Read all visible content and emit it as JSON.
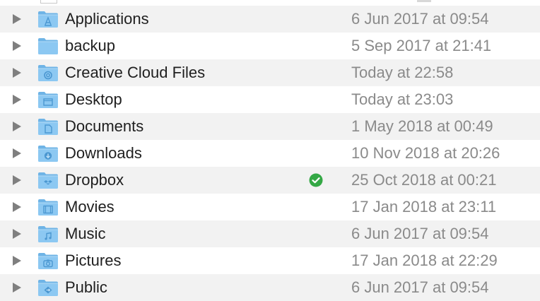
{
  "rows": [
    {
      "name": "Applications",
      "date": "6 Jun 2017 at 09:54",
      "icon": "applications-folder-icon",
      "glyph": "A"
    },
    {
      "name": "backup",
      "date": "5 Sep 2017 at 21:41",
      "icon": "folder-icon",
      "glyph": ""
    },
    {
      "name": "Creative Cloud Files",
      "date": "Today at 22:58",
      "icon": "creative-cloud-folder-icon",
      "glyph": "cc"
    },
    {
      "name": "Desktop",
      "date": "Today at 23:03",
      "icon": "desktop-folder-icon",
      "glyph": "desktop"
    },
    {
      "name": "Documents",
      "date": "1 May 2018 at 00:49",
      "icon": "documents-folder-icon",
      "glyph": "doc"
    },
    {
      "name": "Downloads",
      "date": "10 Nov 2018 at 20:26",
      "icon": "downloads-folder-icon",
      "glyph": "down"
    },
    {
      "name": "Dropbox",
      "date": "25 Oct 2018 at 00:21",
      "icon": "dropbox-folder-icon",
      "glyph": "dropbox",
      "synced": true
    },
    {
      "name": "Movies",
      "date": "17 Jan 2018 at 23:11",
      "icon": "movies-folder-icon",
      "glyph": "film"
    },
    {
      "name": "Music",
      "date": "6 Jun 2017 at 09:54",
      "icon": "music-folder-icon",
      "glyph": "note"
    },
    {
      "name": "Pictures",
      "date": "17 Jan 2018 at 22:29",
      "icon": "pictures-folder-icon",
      "glyph": "camera"
    },
    {
      "name": "Public",
      "date": "6 Jun 2017 at 09:54",
      "icon": "public-folder-icon",
      "glyph": "public"
    }
  ],
  "colors": {
    "folder_front": "#8cc8f2",
    "folder_back": "#6fb4e6",
    "folder_glyph": "#4b97d1",
    "sync_badge": "#34a845",
    "alt_row": "#f2f2f2"
  }
}
